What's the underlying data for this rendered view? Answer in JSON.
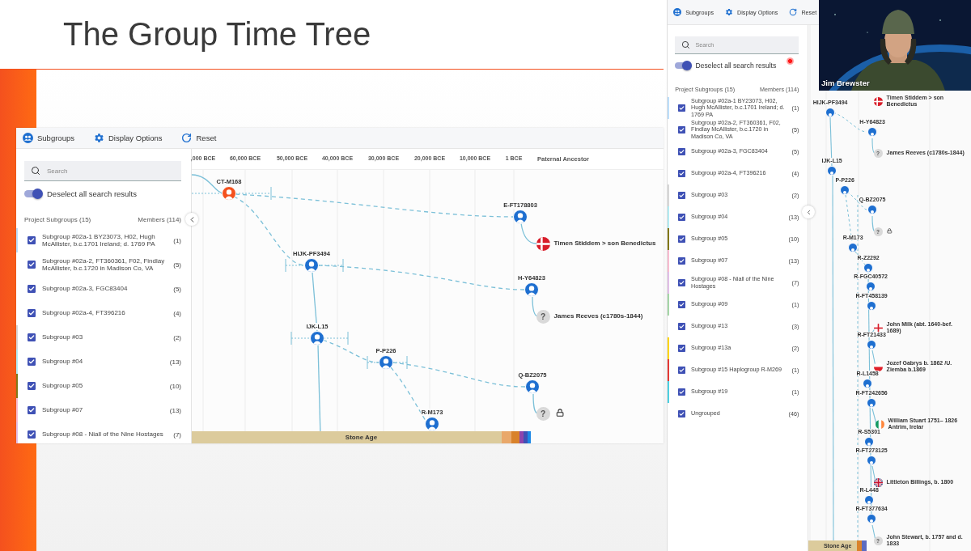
{
  "slide": {
    "title": "The Group Time Tree"
  },
  "left_app": {
    "toolbar": [
      {
        "label": "Subgroups",
        "kind": "subgroups"
      },
      {
        "label": "Display Options",
        "kind": "settings"
      },
      {
        "label": "Reset",
        "kind": "reset"
      }
    ],
    "panel": {
      "search": {
        "placeholder": "Search"
      },
      "toggle": {
        "label": "Deselect all search results",
        "on": true
      },
      "header": {
        "title": "Project Subgroups (15)",
        "members": "Members (114)"
      },
      "items": [
        {
          "label": "Subgroup #02a-1 BY23073, H02, Hugh McAllister, b.c.1701 Ireland; d. 1769 PA",
          "count": "(1)",
          "checked": true,
          "color": "#bbdefb"
        },
        {
          "label": "Subgroup #02a-2, FT360361, F02, Findlay McAllister, b.c.1720 in Madison Co, VA",
          "count": "(5)",
          "checked": true
        },
        {
          "label": "Subgroup #02a-3, FGC83404",
          "count": "(5)",
          "checked": true
        },
        {
          "label": "Subgroup #02a-4, FT396216",
          "count": "(4)",
          "checked": true
        },
        {
          "label": "Subgroup #03",
          "count": "(2)",
          "checked": true,
          "color": "#d6d6d6"
        },
        {
          "label": "Subgroup #04",
          "count": "(13)",
          "checked": true,
          "color": "#b2ebf2"
        },
        {
          "label": "Subgroup #05",
          "count": "(10)",
          "checked": true,
          "color": "#827717"
        },
        {
          "label": "Subgroup #07",
          "count": "(13)",
          "checked": true,
          "color": "#f8bbd0"
        },
        {
          "label": "Subgroup #08 - Niall of the Nine Hostages",
          "count": "(7)",
          "checked": true,
          "color": "#e1bee7"
        }
      ]
    },
    "timeline": {
      "ticks": [
        ",000 BCE",
        "60,000 BCE",
        "50,000 BCE",
        "40,000 BCE",
        "30,000 BCE",
        "20,000 BCE",
        "10,000 BCE",
        "1 BCE"
      ],
      "ancestor_heading": "Paternal Ancestor",
      "era": "Stone Age"
    },
    "nodes": [
      {
        "label": "CT-M168",
        "highlighted": true
      },
      {
        "label": "E-FT178803",
        "highlighted": false
      },
      {
        "label": "HIJK-PF3494",
        "highlighted": false
      },
      {
        "label": "H-Y64823",
        "highlighted": false
      },
      {
        "label": "IJK-L15",
        "highlighted": false
      },
      {
        "label": "P-P226",
        "highlighted": false
      },
      {
        "label": "Q-BZ2075",
        "highlighted": false
      },
      {
        "label": "R-M173",
        "highlighted": false
      }
    ],
    "ancestors": [
      {
        "name": "Timen Stiddem > son Benedictus",
        "kind": "denmark",
        "locked": false
      },
      {
        "name": "James Reeves (c1780s-1844)",
        "kind": "unknown",
        "marker": "?",
        "locked": false
      },
      {
        "kind": "unknown",
        "marker": "?",
        "locked": true
      }
    ]
  },
  "right_app": {
    "toolbar": [
      {
        "label": "Subgroups",
        "kind": "subgroups"
      },
      {
        "label": "Display Options",
        "kind": "settings"
      },
      {
        "label": "Reset",
        "kind": "reset"
      }
    ],
    "panel": {
      "search": {
        "placeholder": "Search"
      },
      "toggle": {
        "label": "Deselect all search results",
        "on": true
      },
      "header": {
        "title": "Project Subgroups (15)",
        "members": "Members (114)"
      },
      "items": [
        {
          "label": "Subgroup #02a-1 BY23073, H02, Hugh McAllister, b.c.1701 Ireland; d. 1769 PA",
          "count": "(1)",
          "checked": true,
          "color": "#bbdefb"
        },
        {
          "label": "Subgroup #02a-2, FT360361, F02, Findlay McAllister, b.c.1720 in Madison Co, VA",
          "count": "(5)",
          "checked": true
        },
        {
          "label": "Subgroup #02a-3, FGC83404",
          "count": "(5)",
          "checked": true
        },
        {
          "label": "Subgroup #02a-4, FT396216",
          "count": "(4)",
          "checked": true
        },
        {
          "label": "Subgroup #03",
          "count": "(2)",
          "checked": true,
          "color": "#d6d6d6"
        },
        {
          "label": "Subgroup #04",
          "count": "(13)",
          "checked": true,
          "color": "#b2ebf2"
        },
        {
          "label": "Subgroup #05",
          "count": "(10)",
          "checked": true,
          "color": "#827717"
        },
        {
          "label": "Subgroup #07",
          "count": "(13)",
          "checked": true,
          "color": "#f8bbd0"
        },
        {
          "label": "Subgroup #08 - Niall of the Nine Hostages",
          "count": "(7)",
          "checked": true,
          "color": "#e1bee7"
        },
        {
          "label": "Subgroup #09",
          "count": "(1)",
          "checked": true,
          "color": "#a5d6a7"
        },
        {
          "label": "Subgroup #13",
          "count": "(3)",
          "checked": true
        },
        {
          "label": "Subgroup #13a",
          "count": "(2)",
          "checked": true,
          "color": "#ffd600"
        },
        {
          "label": "Subgroup #15 Haplogroup R-M269",
          "count": "(1)",
          "checked": true,
          "color": "#e53935"
        },
        {
          "label": "Subgroup #19",
          "count": "(1)",
          "checked": true,
          "color": "#4dd0e1"
        },
        {
          "label": "Ungrouped",
          "count": "(46)",
          "checked": true
        }
      ]
    },
    "era": "Stone Age",
    "nodes": [
      {
        "label": "HIJK-PF3494",
        "highlighted": false
      },
      {
        "label": "H-Y64823",
        "highlighted": false
      },
      {
        "label": "IJK-L15",
        "highlighted": false
      },
      {
        "label": "P-P226",
        "highlighted": false
      },
      {
        "label": "Q-BZ2075",
        "highlighted": false
      },
      {
        "label": "R-M173",
        "highlighted": false
      },
      {
        "label": "R-Z2292",
        "highlighted": false
      },
      {
        "label": "R-FGC40572",
        "highlighted": false
      },
      {
        "label": "R-FT458139",
        "highlighted": false
      },
      {
        "label": "R-FT21433",
        "highlighted": false
      },
      {
        "label": "R-L1458",
        "highlighted": false
      },
      {
        "label": "R-FT242656",
        "highlighted": false
      },
      {
        "label": "R-S5301",
        "highlighted": false
      },
      {
        "label": "R-FT273125",
        "highlighted": false
      },
      {
        "label": "R-L448",
        "highlighted": false
      },
      {
        "label": "R-FT377634",
        "highlighted": false
      }
    ],
    "ancestors": [
      {
        "name": "Timen Stiddem > son Benedictus",
        "kind": "denmark",
        "locked": false
      },
      {
        "name": "James Reeves (c1780s-1844)",
        "kind": "unknown",
        "marker": "?",
        "locked": false
      },
      {
        "kind": "unknown",
        "marker": "?",
        "locked": true
      },
      {
        "name": "John Milk (abt. 1640-bef. 1689)",
        "kind": "england",
        "locked": false
      },
      {
        "name": "Jozef Gabrys b. 1862 /U. Ziemba b.1869",
        "kind": "poland",
        "locked": false
      },
      {
        "name": "William Stuart 1751– 1826 Antrim, Irelar",
        "kind": "ireland",
        "locked": false
      },
      {
        "name": "Littleton Billings, b. 1800",
        "kind": "uk",
        "locked": false
      },
      {
        "name": "John Stewart, b. 1757 and d. 1833",
        "kind": "unknown",
        "marker": "?",
        "locked": false
      }
    ]
  },
  "webcam": {
    "name": "Jim Brewster"
  }
}
